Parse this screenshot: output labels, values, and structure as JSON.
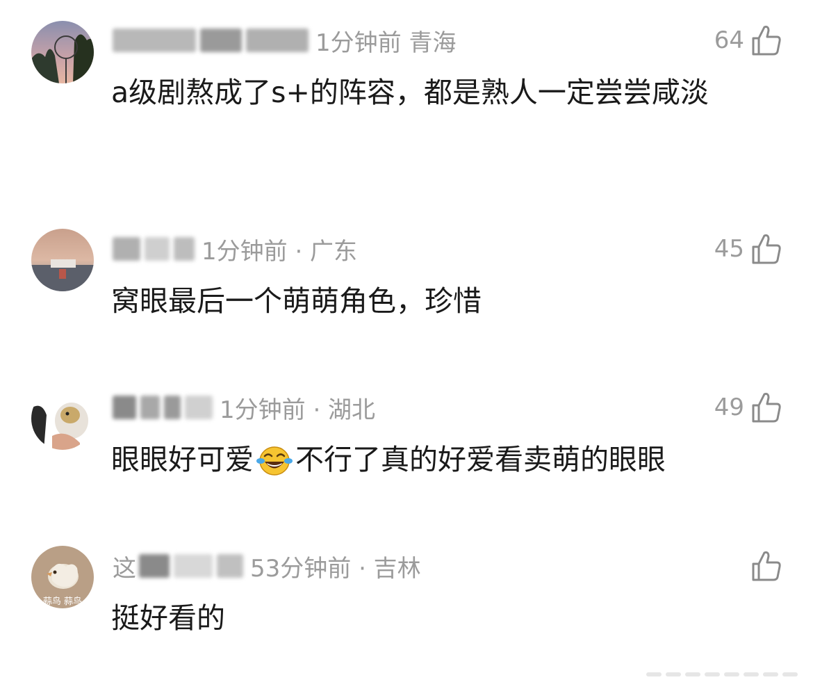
{
  "comments": [
    {
      "meta": "1分钟前  青海",
      "likes": "64",
      "text": "a级剧熬成了s+的阵容，都是熟人一定尝尝咸淡"
    },
    {
      "meta": "1分钟前 · 广东",
      "likes": "45",
      "text": "窝眼最后一个萌萌角色，珍惜"
    },
    {
      "meta": "1分钟前 · 湖北",
      "likes": "49",
      "text_before_emoji": "眼眼好可爱",
      "emoji": "laughing-tears-emoji",
      "text_after_emoji": "不行了真的好爱看卖萌的眼眼"
    },
    {
      "username_prefix": "这",
      "meta": "53分钟前 · 吉林",
      "likes": "",
      "text": "挺好看的",
      "avatar_caption": "蒜鸟 蒜鸟"
    }
  ],
  "icons": {
    "like": "thumbs-up-icon"
  },
  "colors": {
    "text": "#1a1a1a",
    "meta": "#9b9b9b",
    "background": "#ffffff"
  }
}
